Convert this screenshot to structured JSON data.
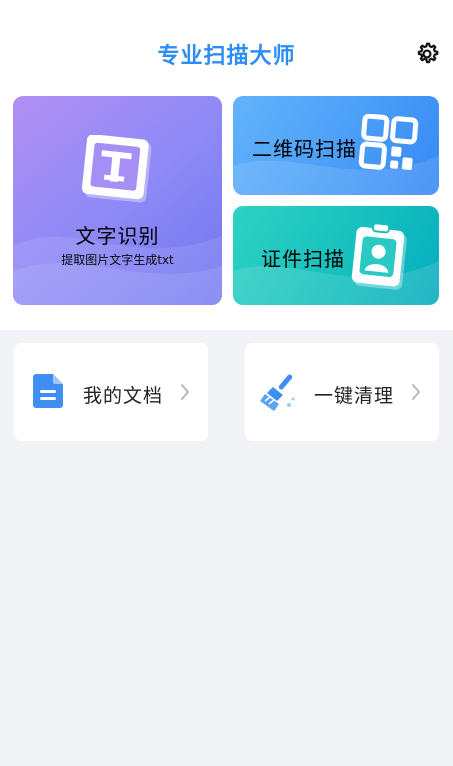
{
  "header": {
    "title": "专业扫描大师",
    "settings_icon": "gear-icon"
  },
  "cards": {
    "ocr": {
      "title": "文字识别",
      "subtitle": "提取图片文字生成txt",
      "icon": "text-recognition-icon"
    },
    "qr": {
      "title": "二维码扫描",
      "icon": "qr-code-icon"
    },
    "id": {
      "title": "证件扫描",
      "icon": "id-card-icon"
    }
  },
  "tools": {
    "docs": {
      "label": "我的文档",
      "icon": "document-icon"
    },
    "clean": {
      "label": "一键清理",
      "icon": "broom-icon"
    }
  },
  "colors": {
    "accent": "#2c8ef2",
    "ocr_gradient": [
      "#b18ff4",
      "#6f76f0"
    ],
    "qr_gradient": [
      "#63b3fb",
      "#3787f4"
    ],
    "id_gradient": [
      "#2fd2c4",
      "#06acc0"
    ],
    "background": "#f2f3f7"
  }
}
